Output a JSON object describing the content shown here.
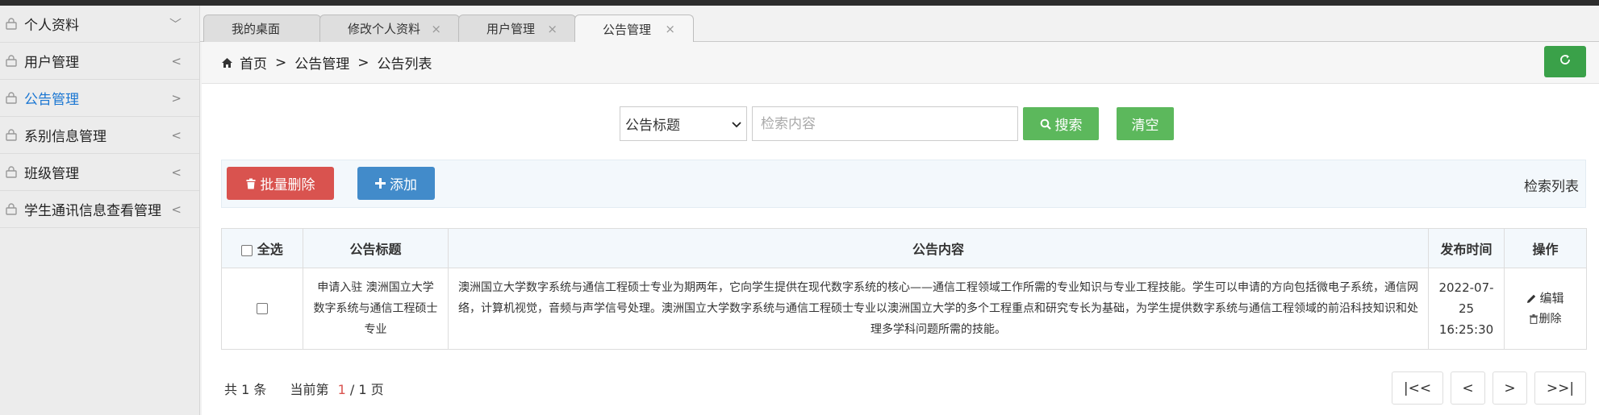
{
  "sidebar": {
    "items": [
      {
        "label": "个人资料",
        "arrow": "﹀",
        "active": false
      },
      {
        "label": "用户管理",
        "arrow": "<",
        "active": false
      },
      {
        "label": "公告管理",
        "arrow": ">",
        "active": true
      },
      {
        "label": "系别信息管理",
        "arrow": "<",
        "active": false
      },
      {
        "label": "班级管理",
        "arrow": "<",
        "active": false
      },
      {
        "label": "学生通讯信息查看管理",
        "arrow": "<",
        "active": false
      }
    ]
  },
  "tabs": [
    {
      "label": "我的桌面",
      "close": ""
    },
    {
      "label": "修改个人资料",
      "close": "×"
    },
    {
      "label": "用户管理",
      "close": "×"
    },
    {
      "label": "公告管理",
      "close": "×"
    }
  ],
  "breadcrumb": {
    "home": "首页",
    "sep1": ">",
    "level1": "公告管理",
    "sep2": ">",
    "level2": "公告列表"
  },
  "search": {
    "field": "公告标题",
    "placeholder": "检索内容",
    "search_label": "搜索",
    "clear_label": "清空"
  },
  "toolbar": {
    "batch_delete": "批量删除",
    "add": "添加",
    "right_label": "检索列表"
  },
  "table": {
    "headers": {
      "select_all": "全选",
      "title": "公告标题",
      "content": "公告内容",
      "time": "发布时间",
      "ops": "操作"
    },
    "rows": [
      {
        "title": "申请入驻 澳洲国立大学数字系统与通信工程硕士专业",
        "content": "澳洲国立大学数字系统与通信工程硕士专业为期两年，它向学生提供在现代数字系统的核心——通信工程领域工作所需的专业知识与专业工程技能。学生可以申请的方向包括微电子系统，通信网络，计算机视觉，音频与声学信号处理。澳洲国立大学数字系统与通信工程硕士专业以澳洲国立大学的多个工程重点和研究专长为基础，为学生提供数字系统与通信工程领域的前沿科技知识和处理多学科问题所需的技能。",
        "time": "2022-07-25 16:25:30",
        "edit": "编辑",
        "delete": "删除"
      }
    ]
  },
  "footer": {
    "total": "共 1 条",
    "page_prefix": "当前第",
    "current_page": "1",
    "page_suffix": "/ 1 页"
  },
  "pager": {
    "first": "|<<",
    "prev": "<",
    "next": ">",
    "last": ">>|"
  },
  "colors": {
    "accent_green": "#5cb85c",
    "danger": "#d9534f",
    "primary": "#428bca",
    "active_link": "#1a76d2"
  }
}
